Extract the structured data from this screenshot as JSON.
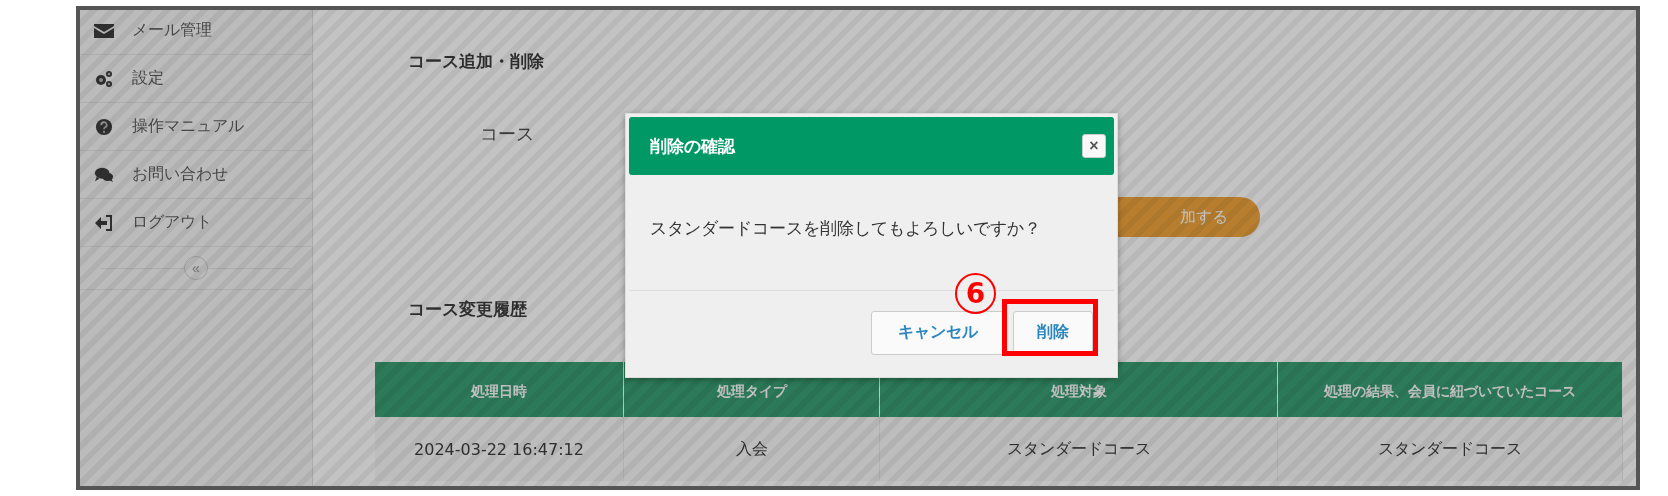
{
  "sidebar": {
    "items": [
      {
        "label": "メール管理"
      },
      {
        "label": "設定"
      },
      {
        "label": "操作マニュアル"
      },
      {
        "label": "お問い合わせ"
      },
      {
        "label": "ログアウト"
      }
    ],
    "collapse": "«"
  },
  "course_section": {
    "title": "コース追加・削除",
    "course_label": "コース",
    "add_button": "加する"
  },
  "history": {
    "title": "コース変更履歴",
    "columns": [
      "処理日時",
      "処理タイプ",
      "処理対象",
      "処理の結果、会員に紐づいていたコース"
    ],
    "rows": [
      [
        "2024-03-22 16:47:12",
        "入会",
        "スタンダードコース",
        "スタンダードコース"
      ]
    ]
  },
  "dialog": {
    "title": "削除の確認",
    "close": "×",
    "message": "スタンダードコースを削除してもよろしいですか？",
    "cancel": "キャンセル",
    "confirm": "削除"
  },
  "annotation": {
    "number": "6"
  }
}
